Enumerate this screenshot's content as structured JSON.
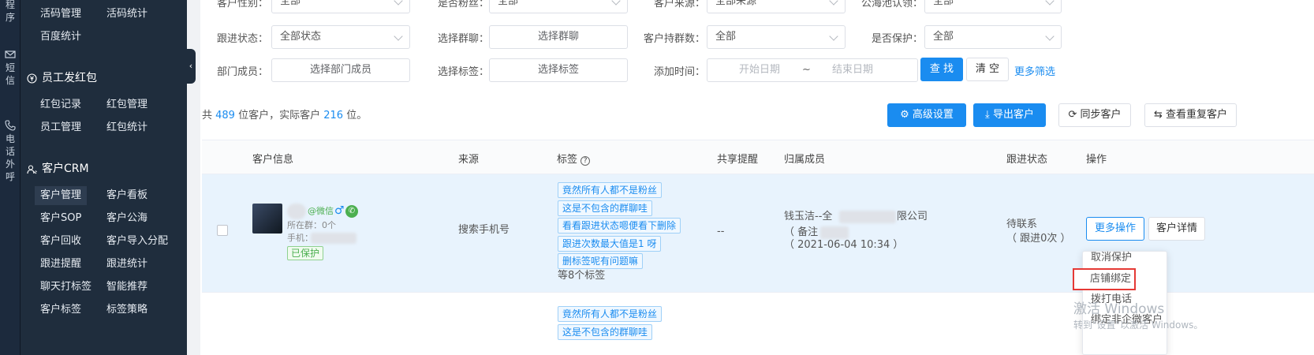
{
  "rail": [
    {
      "label": "程序",
      "icon": "grid-icon"
    },
    {
      "label": "短信",
      "icon": "mail-icon"
    },
    {
      "label": "电话外呼",
      "icon": "phone-icon"
    }
  ],
  "sidebar": {
    "top_items": [
      "活码管理",
      "活码统计",
      "百度统计"
    ],
    "red_packet": {
      "title": "员工发红包",
      "items": [
        "红包记录",
        "红包管理",
        "员工管理",
        "红包统计"
      ]
    },
    "crm": {
      "title": "客户CRM",
      "items": [
        "客户管理",
        "客户看板",
        "客户SOP",
        "客户公海",
        "客户回收",
        "客户导入分配",
        "跟进提醒",
        "跟进统计",
        "聊天打标签",
        "智能推荐",
        "客户标签",
        "标签策略"
      ],
      "active": "客户管理"
    }
  },
  "filters": {
    "row0": [
      {
        "label": "客户性别：",
        "value": "全部"
      },
      {
        "label": "是否粉丝：",
        "value": "全部"
      },
      {
        "label": "客户来源：",
        "value": "全部来源"
      },
      {
        "label": "公海池认领：",
        "value": "全部"
      }
    ],
    "row1": [
      {
        "label": "跟进状态：",
        "value": "全部状态"
      },
      {
        "label": "选择群聊：",
        "value": "选择群聊"
      },
      {
        "label": "客户持群数：",
        "value": "全部"
      },
      {
        "label": "是否保护：",
        "value": "全部"
      }
    ],
    "row2": {
      "member_label": "部门成员：",
      "member_value": "选择部门成员",
      "tag_label": "选择标签：",
      "tag_value": "选择标签",
      "time_label": "添加时间：",
      "start_placeholder": "开始日期",
      "sep": "~",
      "end_placeholder": "结束日期",
      "search_btn": "查 找",
      "clear_btn": "清 空",
      "more_link": "更多筛选"
    }
  },
  "summary": {
    "prefix": "共 ",
    "total": "489",
    "mid": " 位客户，实际客户 ",
    "actual": "216",
    "suffix": " 位。"
  },
  "toolbar": {
    "advanced": "高级设置",
    "export": "导出客户",
    "sync": "同步客户",
    "duplicates": "查看重复客户"
  },
  "table": {
    "headers": [
      "客户信息",
      "来源",
      "标签",
      "共享提醒",
      "归属成员",
      "跟进状态",
      "操作"
    ],
    "row": {
      "wechat": "@微信",
      "gender": "♂",
      "groups": "所在群：0个",
      "phone_label": "手机：",
      "protected": "已保护",
      "source": "搜索手机号",
      "tags": [
        "竟然所有人都不是粉丝",
        "这是不包含的群聊哇",
        "看看跟进状态嗯便看下删除",
        "跟进次数最大值是1 呀",
        "删标签呢有问题嘛"
      ],
      "more_tags": "等8个标签",
      "share": "--",
      "owner_name": "钱玉洁--全",
      "owner_company": "限公司",
      "owner_note": "（ 备注 ",
      "owner_time": "（ 2021-06-04 10:34 ）",
      "status": "待联系",
      "status_count": "（ 跟进0次 ）",
      "more_btn": "更多操作",
      "detail_btn": "客户详情"
    },
    "row2_tags": [
      "竟然所有人都不是粉丝",
      "这是不包含的群聊哇"
    ]
  },
  "menu": [
    "取消保护",
    "店铺绑定",
    "拨打电话",
    "绑定非企微客户"
  ],
  "watermark": {
    "line1": "激活 Windows",
    "line2": "转到\"设置\"以激活 Windows。"
  }
}
